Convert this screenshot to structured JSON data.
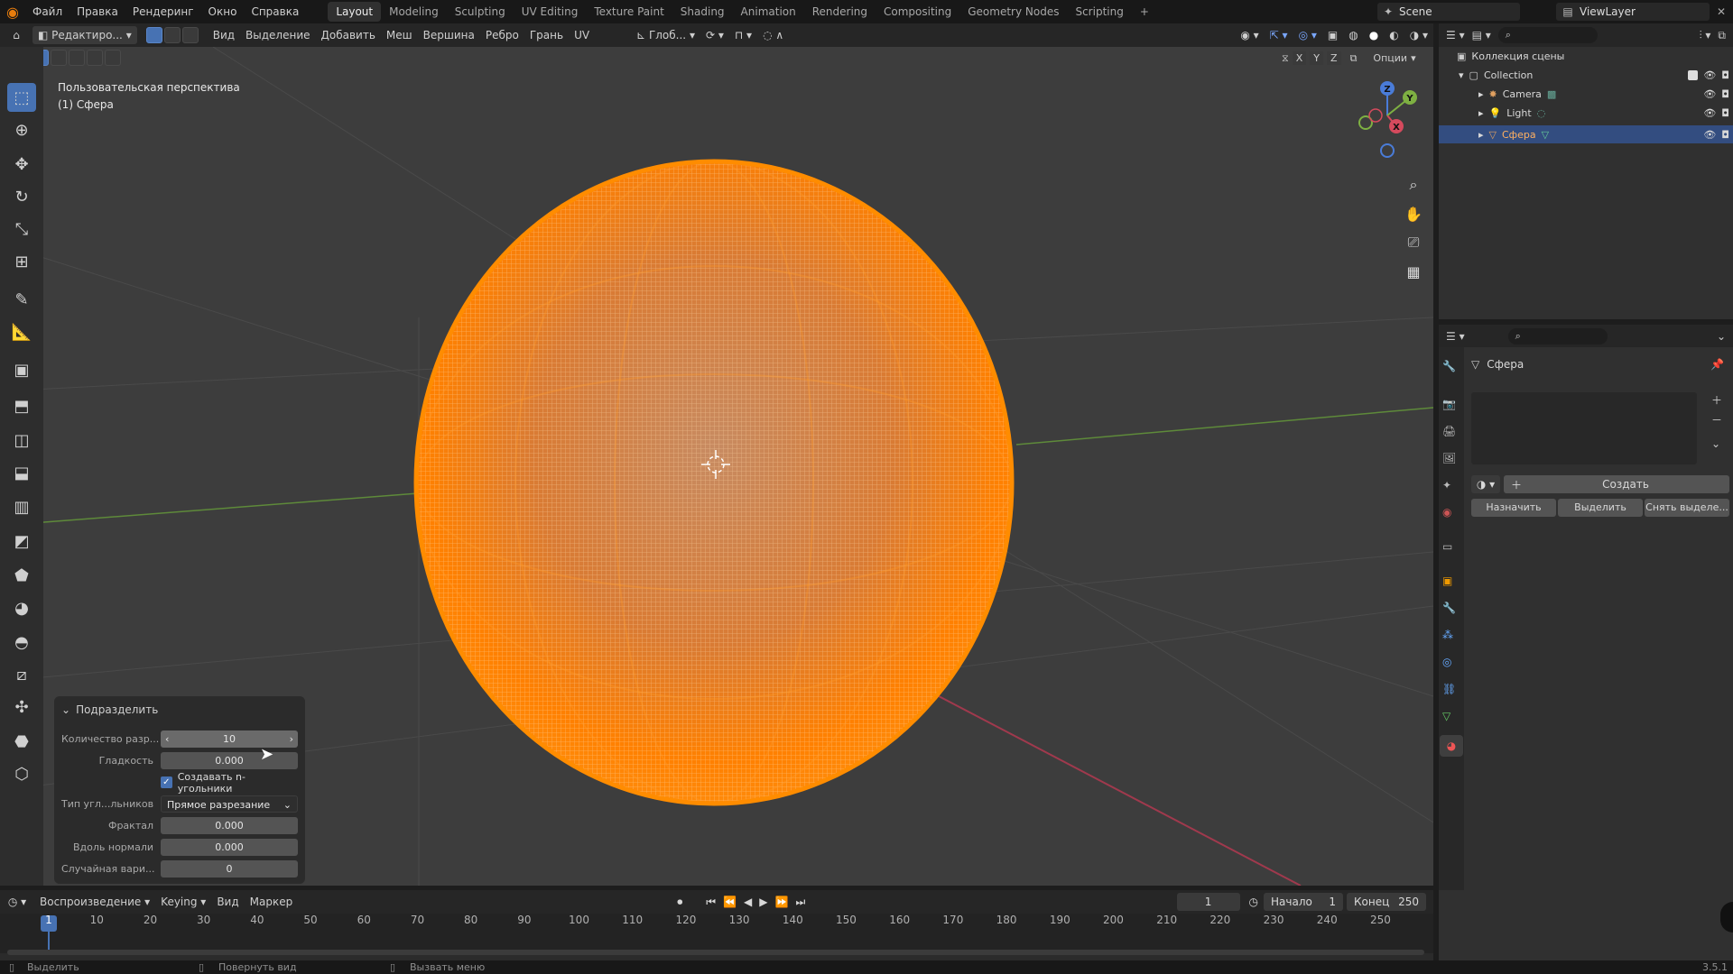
{
  "topbar": {
    "menus": [
      "Файл",
      "Правка",
      "Рендеринг",
      "Окно",
      "Справка"
    ],
    "workspaces": [
      "Layout",
      "Modeling",
      "Sculpting",
      "UV Editing",
      "Texture Paint",
      "Shading",
      "Animation",
      "Rendering",
      "Compositing",
      "Geometry Nodes",
      "Scripting"
    ],
    "active_workspace": "Layout",
    "add_tab": "+",
    "scene": "Scene",
    "view_layer": "ViewLayer"
  },
  "viewport_header": {
    "mode": "Редактиро...",
    "menus": [
      "Вид",
      "Выделение",
      "Добавить",
      "Меш",
      "Вершина",
      "Ребро",
      "Грань",
      "UV"
    ],
    "transform_orientation": "Глоб...",
    "axes": [
      "X",
      "Y",
      "Z"
    ],
    "options_label": "Опции"
  },
  "viewport": {
    "perspective_label": "Пользовательская перспектива",
    "object_label": "(1) Сфера",
    "gizmo_axes": [
      "Z",
      "X",
      "Y"
    ],
    "mesh_color": "#ff8000"
  },
  "operator_panel": {
    "title": "Подразделить",
    "rows": [
      {
        "label": "Количество разр...",
        "value": "10"
      },
      {
        "label": "Гладкость",
        "value": "0.000"
      },
      {
        "label": "Тип угл...льников",
        "value": "Прямое разрезание"
      },
      {
        "label": "Фрактал",
        "value": "0.000"
      },
      {
        "label": "Вдоль нормали",
        "value": "0.000"
      },
      {
        "label": "Случайная вари...",
        "value": "0"
      }
    ],
    "checkbox_label": "Создавать n-угольники",
    "checkbox_checked": true
  },
  "outliner": {
    "root": "Коллекция сцены",
    "collection": "Collection",
    "items": [
      "Camera",
      "Light",
      "Сфера"
    ],
    "selected": "Сфера"
  },
  "properties": {
    "object_name": "Сфера",
    "create_button": "Создать",
    "buttons": [
      "Назначить",
      "Выделить",
      "Снять выделе..."
    ]
  },
  "timeline": {
    "menus": [
      "Воспроизведение",
      "Keying",
      "Вид",
      "Маркер"
    ],
    "current_frame": "1",
    "start_label": "Начало",
    "start_value": "1",
    "end_label": "Конец",
    "end_value": "250",
    "ticks": [
      "1",
      "10",
      "20",
      "30",
      "40",
      "50",
      "60",
      "70",
      "80",
      "90",
      "100",
      "110",
      "120",
      "130",
      "140",
      "150",
      "160",
      "170",
      "180",
      "190",
      "200",
      "210",
      "220",
      "230",
      "240",
      "250"
    ]
  },
  "statusbar": {
    "items": [
      "Выделить",
      "Повернуть вид",
      "Вызвать меню"
    ],
    "version": "3.5.1"
  }
}
